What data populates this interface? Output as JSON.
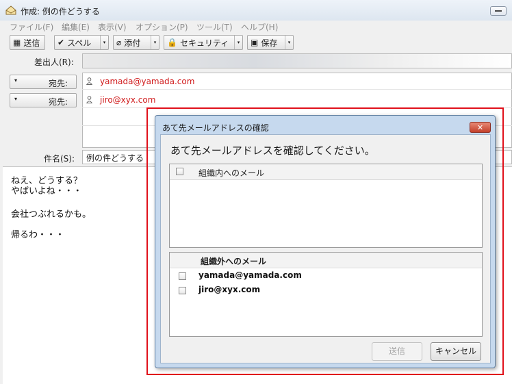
{
  "window": {
    "title": "作成: 例の件どうする"
  },
  "menu": [
    "ファイル(F)",
    "編集(E)",
    "表示(V)",
    "オプション(P)",
    "ツール(T)",
    "ヘルプ(H)"
  ],
  "toolbar": {
    "send": "送信",
    "spell": "スペル",
    "attach": "添付",
    "security": "セキュリティ",
    "save": "保存"
  },
  "headers": {
    "from_label": "差出人(R):",
    "to_label": "宛先:",
    "subject_label": "件名(S):",
    "to": [
      "yamada@yamada.com",
      "jiro@xyx.com"
    ],
    "subject": "例の件どうする"
  },
  "body": [
    "ねえ、どうする？",
    "やばいよね・・・",
    "",
    "会社つぶれるかも。",
    "",
    "帰るわ・・・"
  ],
  "dialog": {
    "title": "あて先メールアドレスの確認",
    "heading": "あて先メールアドレスを確認してください。",
    "internal_title": "組織内へのメール",
    "external_title": "組織外へのメール",
    "external": [
      "yamada@yamada.com",
      "jiro@xyx.com"
    ],
    "send_label": "送信",
    "cancel_label": "キャンセル"
  },
  "colors": {
    "address": "#d0191a",
    "highlight": "#e0101a"
  }
}
